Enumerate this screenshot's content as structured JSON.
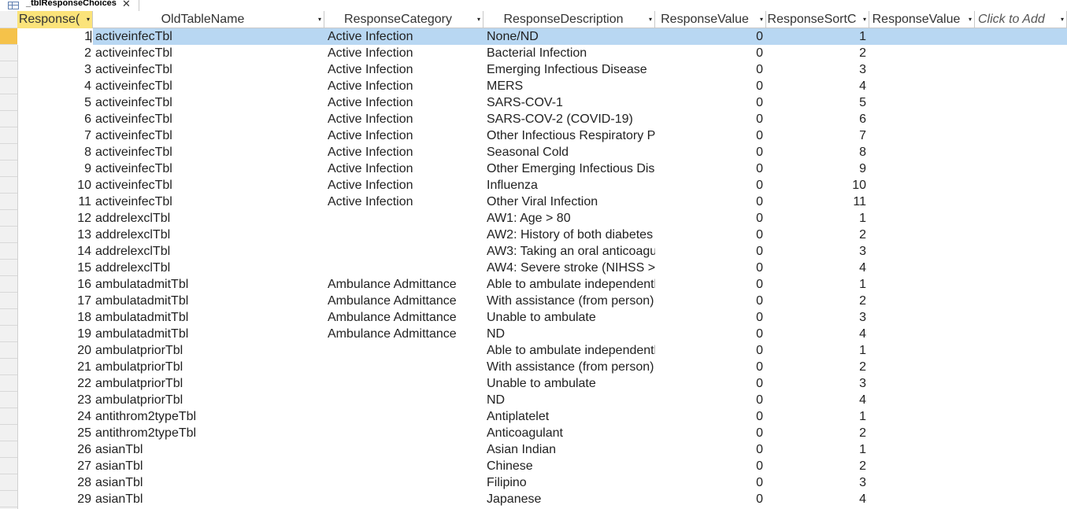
{
  "tab": {
    "title": "_tblResponseChoices",
    "icon": "table-icon",
    "close_icon": "close-icon",
    "close_glyph": "✕"
  },
  "columns": [
    {
      "label": "Response(",
      "key": "id"
    },
    {
      "label": "OldTableName",
      "key": "old"
    },
    {
      "label": "ResponseCategory",
      "key": "cat"
    },
    {
      "label": "ResponseDescription",
      "key": "desc"
    },
    {
      "label": "ResponseValue",
      "key": "val"
    },
    {
      "label": "ResponseSortC",
      "key": "sort"
    },
    {
      "label": "ResponseValue",
      "key": "vt"
    },
    {
      "label": "Click to Add",
      "key": "add"
    }
  ],
  "dropdown_glyph": "▾",
  "selected_row": 0,
  "colors": {
    "active_header": "#fbe37a",
    "selected_row": "#b8d7f2",
    "record_selector_active": "#f5c24a"
  },
  "rows": [
    {
      "id": "1",
      "old": "activeinfecTbl",
      "cat": "Active Infection",
      "desc": "None/ND",
      "val": "0",
      "sort": "1"
    },
    {
      "id": "2",
      "old": "activeinfecTbl",
      "cat": "Active Infection",
      "desc": "Bacterial Infection",
      "val": "0",
      "sort": "2"
    },
    {
      "id": "3",
      "old": "activeinfecTbl",
      "cat": "Active Infection",
      "desc": "Emerging Infectious Disease",
      "val": "0",
      "sort": "3"
    },
    {
      "id": "4",
      "old": "activeinfecTbl",
      "cat": "Active Infection",
      "desc": "MERS",
      "val": "0",
      "sort": "4"
    },
    {
      "id": "5",
      "old": "activeinfecTbl",
      "cat": "Active Infection",
      "desc": "SARS-COV-1",
      "val": "0",
      "sort": "5"
    },
    {
      "id": "6",
      "old": "activeinfecTbl",
      "cat": "Active Infection",
      "desc": "SARS-COV-2 (COVID-19)",
      "val": "0",
      "sort": "6"
    },
    {
      "id": "7",
      "old": "activeinfecTbl",
      "cat": "Active Infection",
      "desc": "Other Infectious Respiratory Pa",
      "val": "0",
      "sort": "7"
    },
    {
      "id": "8",
      "old": "activeinfecTbl",
      "cat": "Active Infection",
      "desc": "Seasonal Cold",
      "val": "0",
      "sort": "8"
    },
    {
      "id": "9",
      "old": "activeinfecTbl",
      "cat": "Active Infection",
      "desc": "Other Emerging Infectious Dise",
      "val": "0",
      "sort": "9"
    },
    {
      "id": "10",
      "old": "activeinfecTbl",
      "cat": "Active Infection",
      "desc": "Influenza",
      "val": "0",
      "sort": "10"
    },
    {
      "id": "11",
      "old": "activeinfecTbl",
      "cat": "Active Infection",
      "desc": "Other Viral Infection",
      "val": "0",
      "sort": "11"
    },
    {
      "id": "12",
      "old": "addrelexclTbl",
      "cat": "",
      "desc": "AW1: Age > 80",
      "val": "0",
      "sort": "1"
    },
    {
      "id": "13",
      "old": "addrelexclTbl",
      "cat": "",
      "desc": "AW2: History of both diabetes",
      "val": "0",
      "sort": "2"
    },
    {
      "id": "14",
      "old": "addrelexclTbl",
      "cat": "",
      "desc": "AW3: Taking an oral anticoagu",
      "val": "0",
      "sort": "3"
    },
    {
      "id": "15",
      "old": "addrelexclTbl",
      "cat": "",
      "desc": "AW4: Severe stroke (NIHSS >",
      "val": "0",
      "sort": "4"
    },
    {
      "id": "16",
      "old": "ambulatadmitTbl",
      "cat": "Ambulance Admittance",
      "desc": "Able to ambulate independentl",
      "val": "0",
      "sort": "1"
    },
    {
      "id": "17",
      "old": "ambulatadmitTbl",
      "cat": "Ambulance Admittance",
      "desc": "With assistance (from person)",
      "val": "0",
      "sort": "2"
    },
    {
      "id": "18",
      "old": "ambulatadmitTbl",
      "cat": "Ambulance Admittance",
      "desc": "Unable to ambulate",
      "val": "0",
      "sort": "3"
    },
    {
      "id": "19",
      "old": "ambulatadmitTbl",
      "cat": "Ambulance Admittance",
      "desc": "ND",
      "val": "0",
      "sort": "4"
    },
    {
      "id": "20",
      "old": "ambulatpriorTbl",
      "cat": "",
      "desc": "Able to ambulate independentl",
      "val": "0",
      "sort": "1"
    },
    {
      "id": "21",
      "old": "ambulatpriorTbl",
      "cat": "",
      "desc": "With assistance (from person)",
      "val": "0",
      "sort": "2"
    },
    {
      "id": "22",
      "old": "ambulatpriorTbl",
      "cat": "",
      "desc": "Unable to ambulate",
      "val": "0",
      "sort": "3"
    },
    {
      "id": "23",
      "old": "ambulatpriorTbl",
      "cat": "",
      "desc": "ND",
      "val": "0",
      "sort": "4"
    },
    {
      "id": "24",
      "old": "antithrom2typeTbl",
      "cat": "",
      "desc": "Antiplatelet",
      "val": "0",
      "sort": "1"
    },
    {
      "id": "25",
      "old": "antithrom2typeTbl",
      "cat": "",
      "desc": "Anticoagulant",
      "val": "0",
      "sort": "2"
    },
    {
      "id": "26",
      "old": "asianTbl",
      "cat": "",
      "desc": "Asian Indian",
      "val": "0",
      "sort": "1"
    },
    {
      "id": "27",
      "old": "asianTbl",
      "cat": "",
      "desc": "Chinese",
      "val": "0",
      "sort": "2"
    },
    {
      "id": "28",
      "old": "asianTbl",
      "cat": "",
      "desc": "Filipino",
      "val": "0",
      "sort": "3"
    },
    {
      "id": "29",
      "old": "asianTbl",
      "cat": "",
      "desc": "Japanese",
      "val": "0",
      "sort": "4"
    }
  ]
}
